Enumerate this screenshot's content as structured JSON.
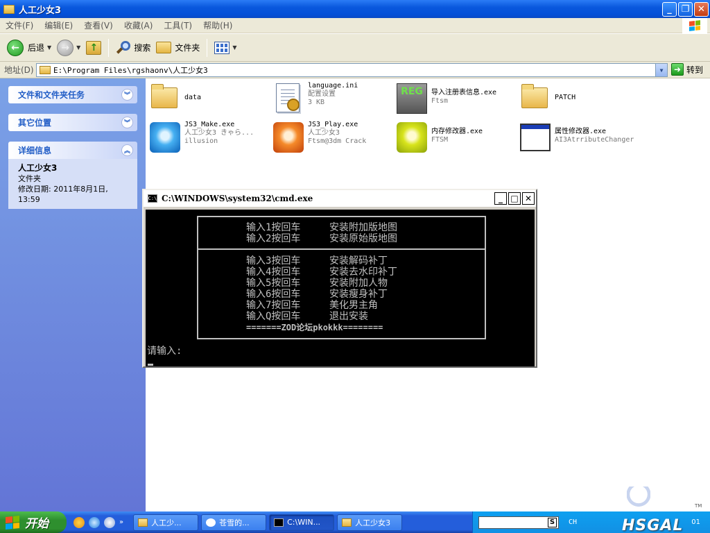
{
  "window": {
    "title": "人工少女3"
  },
  "menu": [
    "文件(F)",
    "编辑(E)",
    "查看(V)",
    "收藏(A)",
    "工具(T)",
    "帮助(H)"
  ],
  "toolbar": {
    "back": "后退",
    "search": "搜索",
    "folders": "文件夹"
  },
  "address": {
    "label": "地址(D)",
    "path": "E:\\Program Files\\rgshaonv\\人工少女3",
    "go": "转到"
  },
  "sidebar": {
    "tasks": "文件和文件夹任务",
    "places": "其它位置",
    "details": "详细信息",
    "detail_name": "人工少女3",
    "detail_type": "文件夹",
    "detail_date": "修改日期: 2011年8月1日, 13:59"
  },
  "files": [
    {
      "name": "data",
      "sub1": "",
      "sub2": ""
    },
    {
      "name": "language.ini",
      "sub1": "配置设置",
      "sub2": "3 KB"
    },
    {
      "name": "导入注册表信息.exe",
      "sub1": "Ftsm",
      "sub2": ""
    },
    {
      "name": "PATCH",
      "sub1": "",
      "sub2": ""
    },
    {
      "name": "JS3_Make.exe",
      "sub1": "人工少女3 きゃら...",
      "sub2": "illusion"
    },
    {
      "name": "JS3_Play.exe",
      "sub1": "人工少女3",
      "sub2": "Ftsm@3dm Crack"
    },
    {
      "name": "内存修改器.exe",
      "sub1": "FTSM",
      "sub2": ""
    },
    {
      "name": "属性修改器.exe",
      "sub1": "AI3AtrributeChanger",
      "sub2": ""
    }
  ],
  "icons": {
    "reg_text": "REG"
  },
  "cmd": {
    "title": "C:\\WINDOWS\\system32\\cmd.exe",
    "group1": [
      {
        "opt": "输入1按回车",
        "desc": "安装附加版地图"
      },
      {
        "opt": "输入2按回车",
        "desc": "安装原始版地图"
      }
    ],
    "group2": [
      {
        "opt": "输入3按回车",
        "desc": "安装解码补丁"
      },
      {
        "opt": "输入4按回车",
        "desc": "安装去水印补丁"
      },
      {
        "opt": "输入5按回车",
        "desc": "安装附加人物"
      },
      {
        "opt": "输入6按回车",
        "desc": "安装瘦身补丁"
      },
      {
        "opt": "输入7按回车",
        "desc": "美化男主角"
      },
      {
        "opt": "输入Q按回车",
        "desc": "退出安装"
      }
    ],
    "footer": "=======ZOD论坛pkokkk========",
    "prompt": "请输入:"
  },
  "taskbar": {
    "start": "开始",
    "tasks": [
      "人工少...",
      "苍雪的...",
      "C:\\WIN...",
      "人工少女3"
    ],
    "ime_s": "S",
    "ime": "CH",
    "brand": "HSGAL",
    "brand_tm": "TM",
    "clock": "01"
  }
}
